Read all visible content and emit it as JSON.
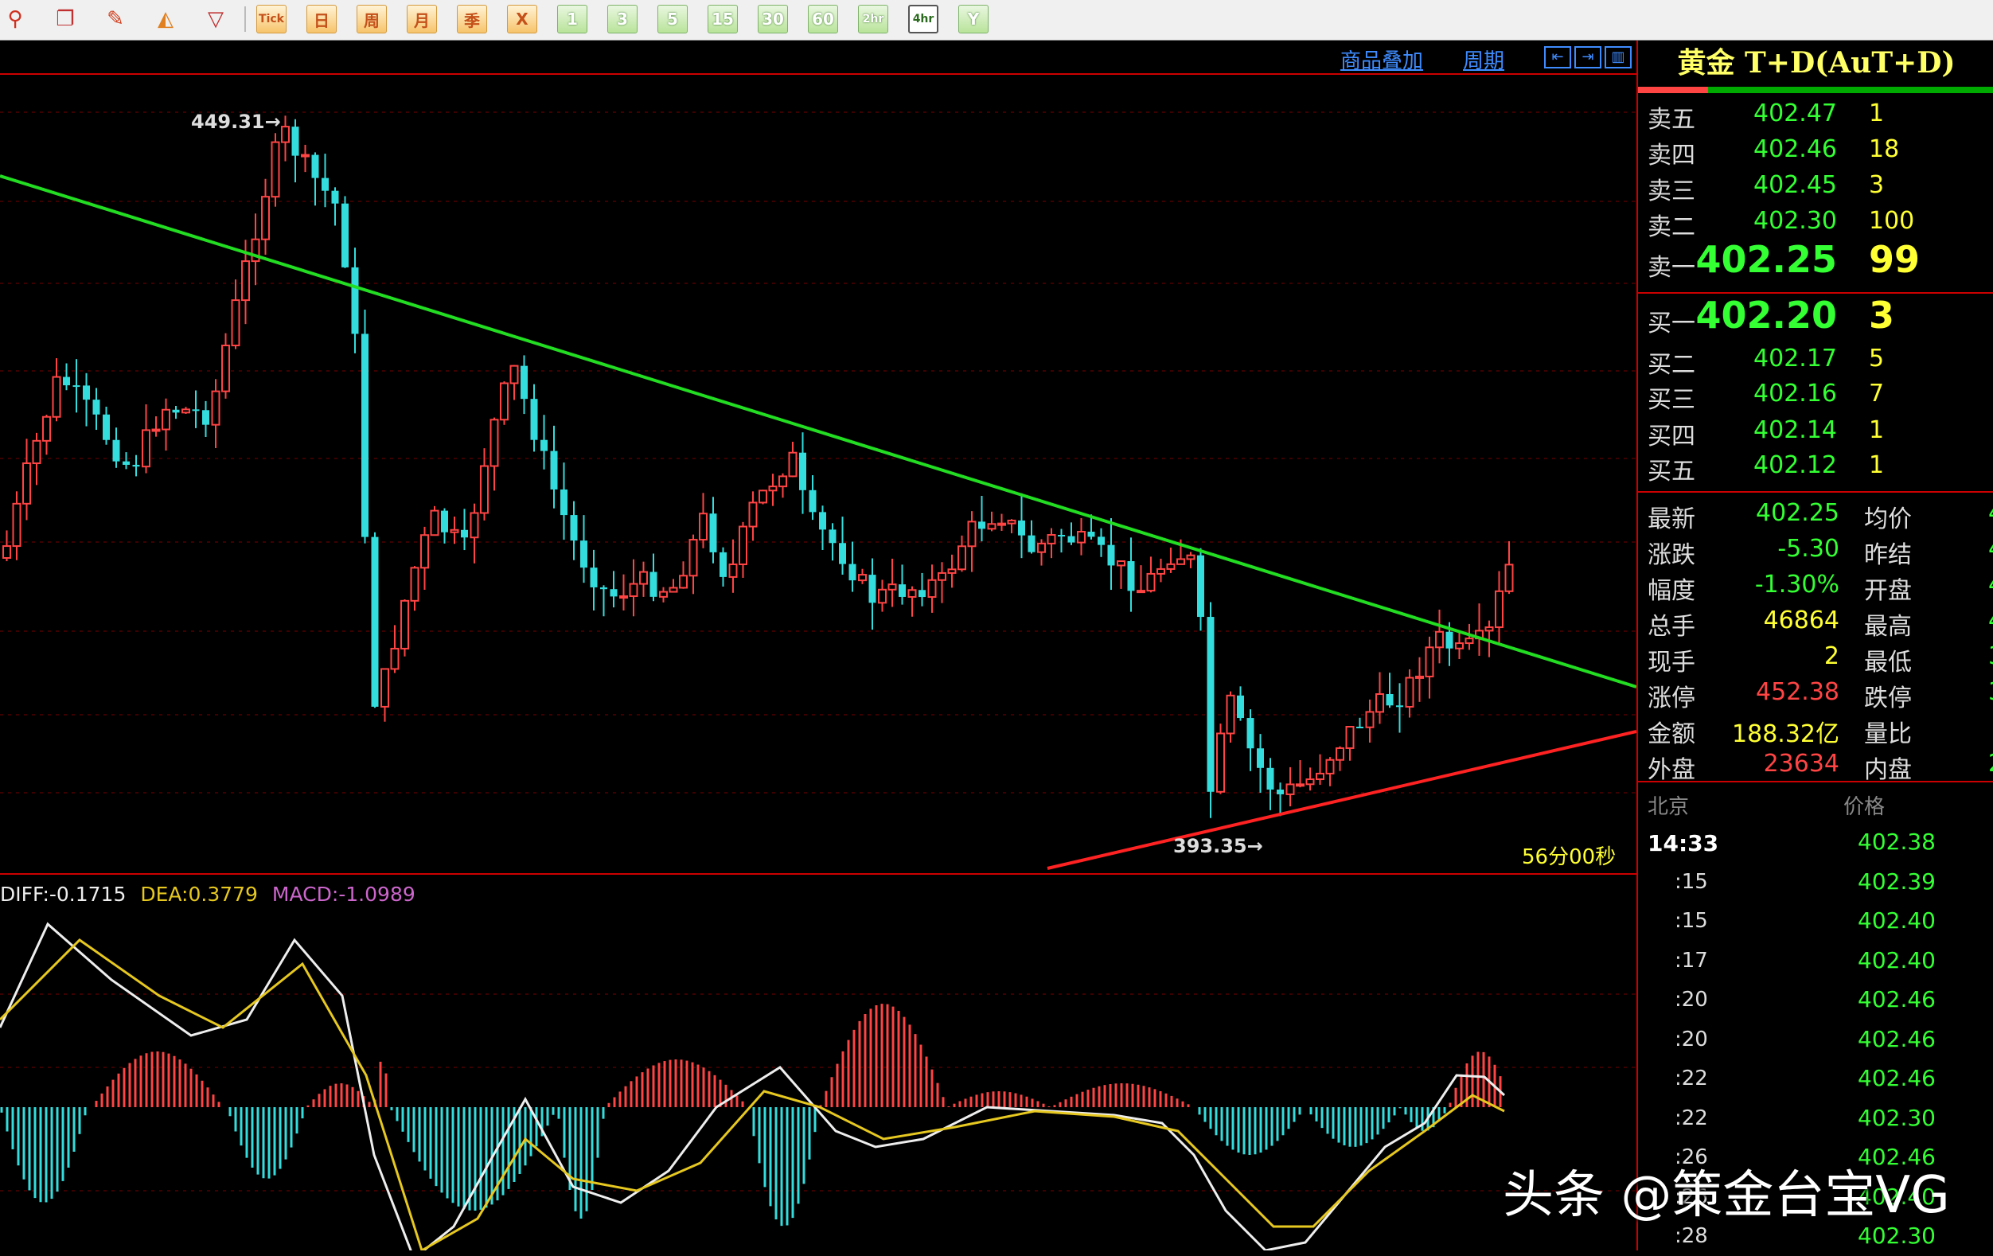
{
  "toolbar": {
    "tools": [
      {
        "name": "search-icon",
        "glyph": "⚲",
        "color": "#d03020"
      },
      {
        "name": "window-icon",
        "glyph": "❐",
        "color": "#c03030"
      },
      {
        "name": "pen-icon",
        "glyph": "✎",
        "color": "#d04020"
      },
      {
        "name": "cone-icon",
        "glyph": "◭",
        "color": "#e08020"
      },
      {
        "name": "filter-icon",
        "glyph": "▽",
        "color": "#c03030"
      },
      {
        "name": "table-icon",
        "glyph": "▤",
        "color": "#3050a0"
      },
      {
        "name": "chart-line-icon",
        "glyph": "↗",
        "color": "#c02020"
      }
    ],
    "periods": [
      "Tick",
      "日",
      "周",
      "月",
      "季",
      "X"
    ],
    "minutes": [
      "1",
      "3",
      "5",
      "15",
      "30",
      "60",
      "2hr",
      "4hr",
      "Y"
    ],
    "active_period": "4hr"
  },
  "chart_header": {
    "overlay_link": "商品叠加",
    "period_link": "周期"
  },
  "main_chart": {
    "high_label": "449.31→",
    "low_label": "393.35→",
    "timer": "56分00秒",
    "colors": {
      "up": "#ff4444",
      "down": "#33dddd",
      "trend_down": "#22dd22",
      "trend_up": "#ff2222"
    }
  },
  "macd": {
    "diff_label": "DIFF:-0.1715",
    "dea_label": "DEA:0.3779",
    "macd_label": "MACD:-1.0989"
  },
  "quote": {
    "title": "黄金 T+D(AuT+D)",
    "asks": [
      {
        "label": "卖五",
        "price": "402.47",
        "vol": "1"
      },
      {
        "label": "卖四",
        "price": "402.46",
        "vol": "18"
      },
      {
        "label": "卖三",
        "price": "402.45",
        "vol": "3"
      },
      {
        "label": "卖二",
        "price": "402.30",
        "vol": "100"
      },
      {
        "label": "卖一",
        "price": "402.25",
        "vol": "99"
      }
    ],
    "bids": [
      {
        "label": "买一",
        "price": "402.20",
        "vol": "3"
      },
      {
        "label": "买二",
        "price": "402.17",
        "vol": "5"
      },
      {
        "label": "买三",
        "price": "402.16",
        "vol": "7"
      },
      {
        "label": "买四",
        "price": "402.14",
        "vol": "1"
      },
      {
        "label": "买五",
        "price": "402.12",
        "vol": "1"
      }
    ],
    "stats": [
      {
        "l1": "最新",
        "v1": "402.25",
        "c1": "#33ff33",
        "l2": "均价",
        "v2": "4"
      },
      {
        "l1": "涨跌",
        "v1": "-5.30",
        "c1": "#33ff33",
        "l2": "昨结",
        "v2": "4"
      },
      {
        "l1": "幅度",
        "v1": "-1.30%",
        "c1": "#33ff33",
        "l2": "开盘",
        "v2": "4"
      },
      {
        "l1": "总手",
        "v1": "46864",
        "c1": "#ffff33",
        "l2": "最高",
        "v2": "4"
      },
      {
        "l1": "现手",
        "v1": "2",
        "c1": "#ffff33",
        "l2": "最低",
        "v2": "3"
      },
      {
        "l1": "涨停",
        "v1": "452.38",
        "c1": "#ff4444",
        "l2": "跌停",
        "v2": "3"
      },
      {
        "l1": "金额",
        "v1": "188.32亿",
        "c1": "#ffff33",
        "l2": "量比",
        "v2": ""
      },
      {
        "l1": "外盘",
        "v1": "23634",
        "c1": "#ff4444",
        "l2": "内盘",
        "v2": "2"
      }
    ],
    "ticks_header": {
      "time": "北京",
      "price": "价格"
    },
    "ticks": [
      {
        "time": "14:33",
        "price": "402.38"
      },
      {
        "time": ":15",
        "price": "402.39"
      },
      {
        "time": ":15",
        "price": "402.40"
      },
      {
        "time": ":17",
        "price": "402.40"
      },
      {
        "time": ":20",
        "price": "402.46"
      },
      {
        "time": ":20",
        "price": "402.46"
      },
      {
        "time": ":22",
        "price": "402.46"
      },
      {
        "time": ":22",
        "price": "402.30"
      },
      {
        "time": ":26",
        "price": "402.46"
      },
      {
        "time": ":26",
        "price": "402.40"
      },
      {
        "time": ":28",
        "price": "402.30"
      }
    ]
  },
  "watermark": "头条 @策金台宝VG"
}
